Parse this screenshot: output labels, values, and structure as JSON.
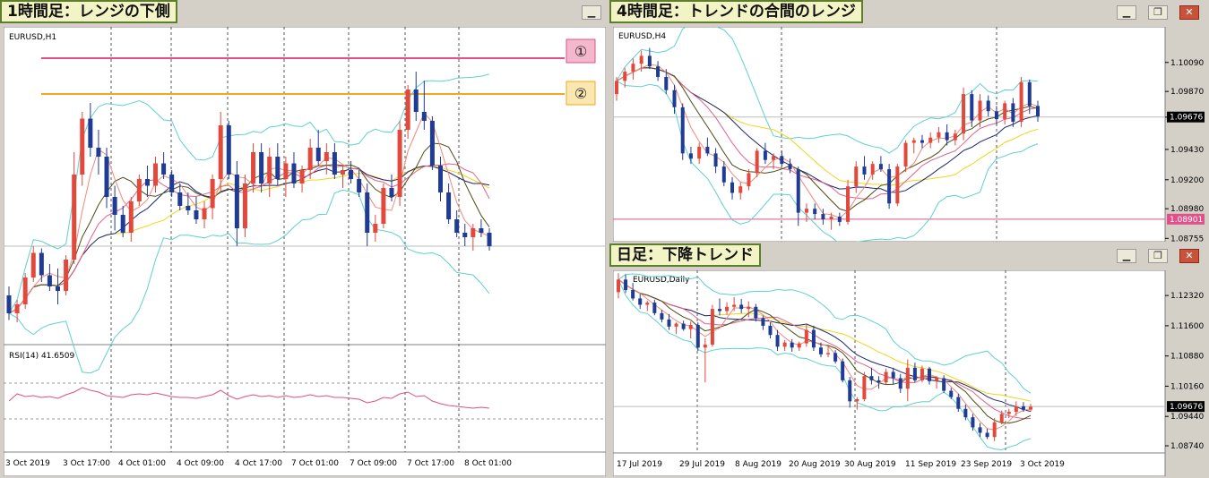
{
  "colors": {
    "bull": "#e2483b",
    "bear": "#1f3b94",
    "bband": "#5fd0d0",
    "ma_yellow": "#f1d51a",
    "ma_navy": "#1a2570",
    "ma_pink": "#e25f8c",
    "ma_olive": "#4c4c12",
    "ma_salmon": "#f08a7a",
    "rsi": "#e04f86",
    "hline_pink": "#e0508a",
    "hline_orange": "#f0a820",
    "grid": "#555555"
  },
  "windows": [
    {
      "title": "1時間足：レンジの下側",
      "controls": [
        "minimize"
      ]
    },
    {
      "title": "4時間足：トレンドの合間のレンジ",
      "controls": [
        "minimize",
        "restore",
        "close"
      ]
    },
    {
      "title": "日足：下降トレンド",
      "controls": [
        "minimize",
        "restore",
        "close"
      ]
    }
  ],
  "chart_data": [
    {
      "type": "candlestick",
      "symbol_label": "EURUSD,H1",
      "x_tick_labels": [
        "3 Oct 2019",
        "3 Oct 17:00",
        "4 Oct 01:00",
        "4 Oct 09:00",
        "4 Oct 17:00",
        "7 Oct 01:00",
        "7 Oct 09:00",
        "7 Oct 17:00",
        "8 Oct 01:00"
      ],
      "annotations": [
        {
          "label": "①",
          "kind": "resistance-line"
        },
        {
          "label": "②",
          "kind": "resistance-line"
        }
      ],
      "ohlc": [
        [
          1.0966,
          1.097,
          1.0955,
          1.0958
        ],
        [
          1.0958,
          1.0964,
          1.0954,
          1.0962
        ],
        [
          1.0962,
          1.0976,
          1.096,
          1.0974
        ],
        [
          1.0974,
          1.0988,
          1.0972,
          1.0985
        ],
        [
          1.0985,
          1.0987,
          1.0972,
          1.0975
        ],
        [
          1.0975,
          1.098,
          1.0968,
          1.097
        ],
        [
          1.097,
          1.0978,
          1.0962,
          1.0968
        ],
        [
          1.0968,
          1.0984,
          1.0966,
          1.0982
        ],
        [
          1.0982,
          1.103,
          1.098,
          1.102
        ],
        [
          1.102,
          1.1048,
          1.1015,
          1.1045
        ],
        [
          1.1045,
          1.1052,
          1.1028,
          1.1032
        ],
        [
          1.1032,
          1.104,
          1.102,
          1.1028
        ],
        [
          1.1028,
          1.1032,
          1.1005,
          1.101
        ],
        [
          1.101,
          1.1015,
          1.0995,
          1.1002
        ],
        [
          1.1002,
          1.1006,
          1.0992,
          1.0994
        ],
        [
          1.0994,
          1.101,
          1.099,
          1.1008
        ],
        [
          1.1008,
          1.102,
          1.1006,
          1.1018
        ],
        [
          1.1018,
          1.1024,
          1.101,
          1.1015
        ],
        [
          1.1015,
          1.1028,
          1.1012,
          1.1025
        ],
        [
          1.1025,
          1.103,
          1.1018,
          1.102
        ],
        [
          1.102,
          1.1022,
          1.101,
          1.1012
        ],
        [
          1.1012,
          1.1016,
          1.1004,
          1.1006
        ],
        [
          1.1006,
          1.1012,
          1.1002,
          1.1004
        ],
        [
          1.1004,
          1.101,
          1.0998,
          1.1
        ],
        [
          1.1,
          1.1008,
          1.0996,
          1.1005
        ],
        [
          1.1005,
          1.102,
          1.1,
          1.1018
        ],
        [
          1.1018,
          1.1048,
          1.1012,
          1.1042
        ],
        [
          1.1042,
          1.1044,
          1.1018,
          1.102
        ],
        [
          1.102,
          1.1026,
          1.0988,
          1.0996
        ],
        [
          1.0996,
          1.102,
          1.0992,
          1.1016
        ],
        [
          1.1016,
          1.1034,
          1.1012,
          1.103
        ],
        [
          1.103,
          1.1034,
          1.1012,
          1.1016
        ],
        [
          1.1016,
          1.1032,
          1.101,
          1.1028
        ],
        [
          1.1028,
          1.1034,
          1.1015,
          1.1018
        ],
        [
          1.1018,
          1.1028,
          1.101,
          1.1025
        ],
        [
          1.1025,
          1.103,
          1.1014,
          1.1016
        ],
        [
          1.1016,
          1.1024,
          1.1012,
          1.1022
        ],
        [
          1.1022,
          1.1036,
          1.1018,
          1.1032
        ],
        [
          1.1032,
          1.104,
          1.1024,
          1.1026
        ],
        [
          1.1026,
          1.1034,
          1.102,
          1.103
        ],
        [
          1.103,
          1.1034,
          1.1018,
          1.102
        ],
        [
          1.102,
          1.1024,
          1.1014,
          1.1022
        ],
        [
          1.1022,
          1.1026,
          1.1016,
          1.1018
        ],
        [
          1.1018,
          1.1022,
          1.101,
          1.1012
        ],
        [
          1.1012,
          1.1016,
          1.0988,
          1.0994
        ],
        [
          1.0994,
          1.1002,
          1.099,
          1.0998
        ],
        [
          1.0998,
          1.1016,
          1.0996,
          1.1014
        ],
        [
          1.1014,
          1.102,
          1.1008,
          1.101
        ],
        [
          1.101,
          1.1044,
          1.1006,
          1.104
        ],
        [
          1.104,
          1.106,
          1.1036,
          1.1058
        ],
        [
          1.1058,
          1.1066,
          1.1044,
          1.1048
        ],
        [
          1.1048,
          1.1062,
          1.104,
          1.1044
        ],
        [
          1.1044,
          1.1046,
          1.1022,
          1.1024
        ],
        [
          1.1024,
          1.1028,
          1.1008,
          1.1012
        ],
        [
          1.1012,
          1.1016,
          1.0998,
          1.1
        ],
        [
          1.1,
          1.1004,
          1.0992,
          1.0994
        ],
        [
          1.0994,
          1.0998,
          1.0988,
          1.0992
        ],
        [
          1.0992,
          1.0998,
          1.0986,
          1.0996
        ],
        [
          1.0996,
          1.1,
          1.0992,
          1.0994
        ],
        [
          1.0994,
          1.0996,
          1.0986,
          1.0988
        ]
      ],
      "rsi": {
        "label": "RSI(14) 41.6509",
        "levels": [
          70,
          30
        ],
        "values": [
          50,
          58,
          55,
          56,
          54,
          55,
          53,
          57,
          60,
          65,
          62,
          60,
          56,
          55,
          54,
          57,
          58,
          57,
          59,
          57,
          55,
          54,
          54,
          53,
          55,
          57,
          62,
          56,
          52,
          55,
          57,
          55,
          56,
          54,
          56,
          54,
          55,
          57,
          55,
          56,
          54,
          54,
          53,
          52,
          48,
          50,
          54,
          53,
          58,
          60,
          55,
          56,
          50,
          47,
          45,
          44,
          43,
          42,
          43,
          42
        ]
      }
    },
    {
      "type": "candlestick",
      "symbol_label": "EURUSD,H4",
      "ylim": [
        1.0873,
        1.1036
      ],
      "y_tick_labels": [
        "1.10090",
        "1.09870",
        "1.09675",
        "1.09430",
        "1.09200",
        "1.08980",
        "1.08755"
      ],
      "current_price": "1.09676",
      "hline": {
        "label": "1.08901",
        "value": 1.08901
      },
      "ohlc": [
        [
          1.0985,
          1.0998,
          1.098,
          1.0995
        ],
        [
          1.0995,
          1.1005,
          1.099,
          1.1002
        ],
        [
          1.1002,
          1.1012,
          1.0996,
          1.1008
        ],
        [
          1.1008,
          1.1018,
          1.1002,
          1.1014
        ],
        [
          1.1014,
          1.102,
          1.1004,
          1.1006
        ],
        [
          1.1006,
          1.101,
          1.0995,
          1.0998
        ],
        [
          1.0998,
          1.1004,
          1.0985,
          1.0988
        ],
        [
          1.0988,
          1.0992,
          1.097,
          1.0975
        ],
        [
          1.0975,
          1.0978,
          1.0935,
          1.094
        ],
        [
          1.094,
          1.0945,
          1.0932,
          1.0936
        ],
        [
          1.0936,
          1.0948,
          1.0932,
          1.0945
        ],
        [
          1.0945,
          1.0952,
          1.0938,
          1.094
        ],
        [
          1.094,
          1.0944,
          1.0925,
          1.093
        ],
        [
          1.093,
          1.0934,
          1.0915,
          1.0918
        ],
        [
          1.0918,
          1.0922,
          1.0905,
          1.091
        ],
        [
          1.091,
          1.0918,
          1.0905,
          1.0915
        ],
        [
          1.0915,
          1.0928,
          1.0912,
          1.0925
        ],
        [
          1.0925,
          1.0944,
          1.0922,
          1.0942
        ],
        [
          1.0942,
          1.0948,
          1.0932,
          1.0935
        ],
        [
          1.0935,
          1.094,
          1.0928,
          1.0938
        ],
        [
          1.0938,
          1.0942,
          1.093,
          1.0932
        ],
        [
          1.0932,
          1.0936,
          1.0925,
          1.0928
        ],
        [
          1.0928,
          1.093,
          1.0885,
          1.0895
        ],
        [
          1.0895,
          1.0902,
          1.0888,
          1.0898
        ],
        [
          1.0898,
          1.0902,
          1.089,
          1.0894
        ],
        [
          1.0894,
          1.0898,
          1.0886,
          1.089
        ],
        [
          1.089,
          1.0895,
          1.0882,
          1.0892
        ],
        [
          1.0892,
          1.0895,
          1.0885,
          1.0888
        ],
        [
          1.0888,
          1.092,
          1.0886,
          1.0915
        ],
        [
          1.0915,
          1.0934,
          1.091,
          1.093
        ],
        [
          1.093,
          1.0938,
          1.092,
          1.0924
        ],
        [
          1.0924,
          1.0934,
          1.092,
          1.0932
        ],
        [
          1.0932,
          1.0938,
          1.0926,
          1.0928
        ],
        [
          1.0928,
          1.0932,
          1.0898,
          1.0902
        ],
        [
          1.0902,
          1.0932,
          1.09,
          1.093
        ],
        [
          1.093,
          1.095,
          1.0926,
          1.0948
        ],
        [
          1.0948,
          1.0952,
          1.094,
          1.095
        ],
        [
          1.095,
          1.0954,
          1.0944,
          1.0948
        ],
        [
          1.0948,
          1.0956,
          1.0944,
          1.0952
        ],
        [
          1.0952,
          1.096,
          1.0948,
          1.0956
        ],
        [
          1.0956,
          1.0962,
          1.0946,
          1.095
        ],
        [
          1.095,
          1.0958,
          1.0946,
          1.0955
        ],
        [
          1.0955,
          1.099,
          1.095,
          1.0985
        ],
        [
          1.0985,
          1.0988,
          1.096,
          1.0965
        ],
        [
          1.0965,
          1.0985,
          1.096,
          1.098
        ],
        [
          1.098,
          1.0984,
          1.0968,
          1.0972
        ],
        [
          1.0972,
          1.0976,
          1.0962,
          1.0966
        ],
        [
          1.0966,
          1.098,
          1.0962,
          1.0978
        ],
        [
          1.0978,
          1.0982,
          1.096,
          1.0964
        ],
        [
          1.0964,
          1.0998,
          1.096,
          1.0994
        ],
        [
          1.0994,
          1.0996,
          1.097,
          1.0976
        ],
        [
          1.0976,
          1.098,
          1.0964,
          1.0968
        ]
      ]
    },
    {
      "type": "candlestick",
      "symbol_label": "EURUSD,Daily",
      "ylim": [
        1.0857,
        1.1292
      ],
      "x_tick_labels": [
        "17 Jul 2019",
        "29 Jul 2019",
        "8 Aug 2019",
        "20 Aug 2019",
        "30 Aug 2019",
        "11 Sep 2019",
        "23 Sep 2019",
        "3 Oct 2019"
      ],
      "y_tick_labels": [
        "1.12320",
        "1.11600",
        "1.10880",
        "1.10160",
        "1.09440",
        "1.08740"
      ],
      "current_price": "1.09676",
      "ohlc": [
        [
          1.124,
          1.1285,
          1.1225,
          1.127
        ],
        [
          1.127,
          1.1282,
          1.1238,
          1.1245
        ],
        [
          1.1245,
          1.1262,
          1.122,
          1.1225
        ],
        [
          1.1225,
          1.1236,
          1.12,
          1.121
        ],
        [
          1.121,
          1.122,
          1.1195,
          1.1215
        ],
        [
          1.1215,
          1.1222,
          1.1185,
          1.119
        ],
        [
          1.119,
          1.1198,
          1.1168,
          1.1175
        ],
        [
          1.1175,
          1.1188,
          1.115,
          1.1158
        ],
        [
          1.1158,
          1.1168,
          1.114,
          1.1165
        ],
        [
          1.1165,
          1.1172,
          1.1148,
          1.1152
        ],
        [
          1.1152,
          1.117,
          1.113,
          1.1162
        ],
        [
          1.1162,
          1.1168,
          1.11,
          1.1108
        ],
        [
          1.1108,
          1.113,
          1.1025,
          1.1115
        ],
        [
          1.1115,
          1.121,
          1.111,
          1.12
        ],
        [
          1.12,
          1.1225,
          1.1185,
          1.1195
        ],
        [
          1.1195,
          1.1216,
          1.1186,
          1.1205
        ],
        [
          1.1205,
          1.1228,
          1.1195,
          1.121
        ],
        [
          1.121,
          1.1224,
          1.119,
          1.12
        ],
        [
          1.12,
          1.1218,
          1.118,
          1.1205
        ],
        [
          1.1205,
          1.1212,
          1.117,
          1.1178
        ],
        [
          1.1178,
          1.1184,
          1.115,
          1.116
        ],
        [
          1.116,
          1.1168,
          1.113,
          1.1138
        ],
        [
          1.1138,
          1.115,
          1.11,
          1.111
        ],
        [
          1.111,
          1.1126,
          1.11,
          1.112
        ],
        [
          1.112,
          1.1128,
          1.1098,
          1.1108
        ],
        [
          1.1108,
          1.1122,
          1.11,
          1.1118
        ],
        [
          1.1118,
          1.1162,
          1.111,
          1.115
        ],
        [
          1.115,
          1.116,
          1.11,
          1.1108
        ],
        [
          1.1108,
          1.112,
          1.1085,
          1.1092
        ],
        [
          1.1092,
          1.1112,
          1.1085,
          1.1095
        ],
        [
          1.1095,
          1.1102,
          1.107,
          1.1075
        ],
        [
          1.1075,
          1.1082,
          1.1025,
          1.103
        ],
        [
          1.103,
          1.1038,
          1.0965,
          1.098
        ],
        [
          1.098,
          1.099,
          1.096,
          1.0985
        ],
        [
          1.0985,
          1.105,
          1.098,
          1.104
        ],
        [
          1.104,
          1.106,
          1.102,
          1.103
        ],
        [
          1.103,
          1.104,
          1.101,
          1.1025
        ],
        [
          1.1025,
          1.1058,
          1.102,
          1.105
        ],
        [
          1.105,
          1.106,
          1.102,
          1.1035
        ],
        [
          1.1035,
          1.1045,
          1.1,
          1.101
        ],
        [
          1.101,
          1.108,
          1.098,
          1.106
        ],
        [
          1.106,
          1.1072,
          1.1025,
          1.103
        ],
        [
          1.103,
          1.1065,
          1.1025,
          1.1058
        ],
        [
          1.1058,
          1.1062,
          1.102,
          1.1028
        ],
        [
          1.1028,
          1.104,
          1.101,
          1.1035
        ],
        [
          1.1035,
          1.1042,
          1.1,
          1.1005
        ],
        [
          1.1005,
          1.1012,
          1.0985,
          1.099
        ],
        [
          1.099,
          1.0998,
          1.0955,
          1.0962
        ],
        [
          1.0962,
          1.0972,
          1.0935,
          1.0942
        ],
        [
          1.0942,
          1.095,
          1.091,
          1.0918
        ],
        [
          1.0918,
          1.0928,
          1.0895,
          1.0905
        ],
        [
          1.0905,
          1.0915,
          1.089,
          1.0895
        ],
        [
          1.0895,
          1.094,
          1.0885,
          1.093
        ],
        [
          1.093,
          1.0958,
          1.0925,
          1.095
        ],
        [
          1.095,
          1.0962,
          1.094,
          1.0955
        ],
        [
          1.0955,
          1.098,
          1.0945,
          1.0968
        ],
        [
          1.0968,
          1.0978,
          1.0955,
          1.096
        ],
        [
          1.096,
          1.0974,
          1.0955,
          1.0967
        ]
      ]
    }
  ]
}
